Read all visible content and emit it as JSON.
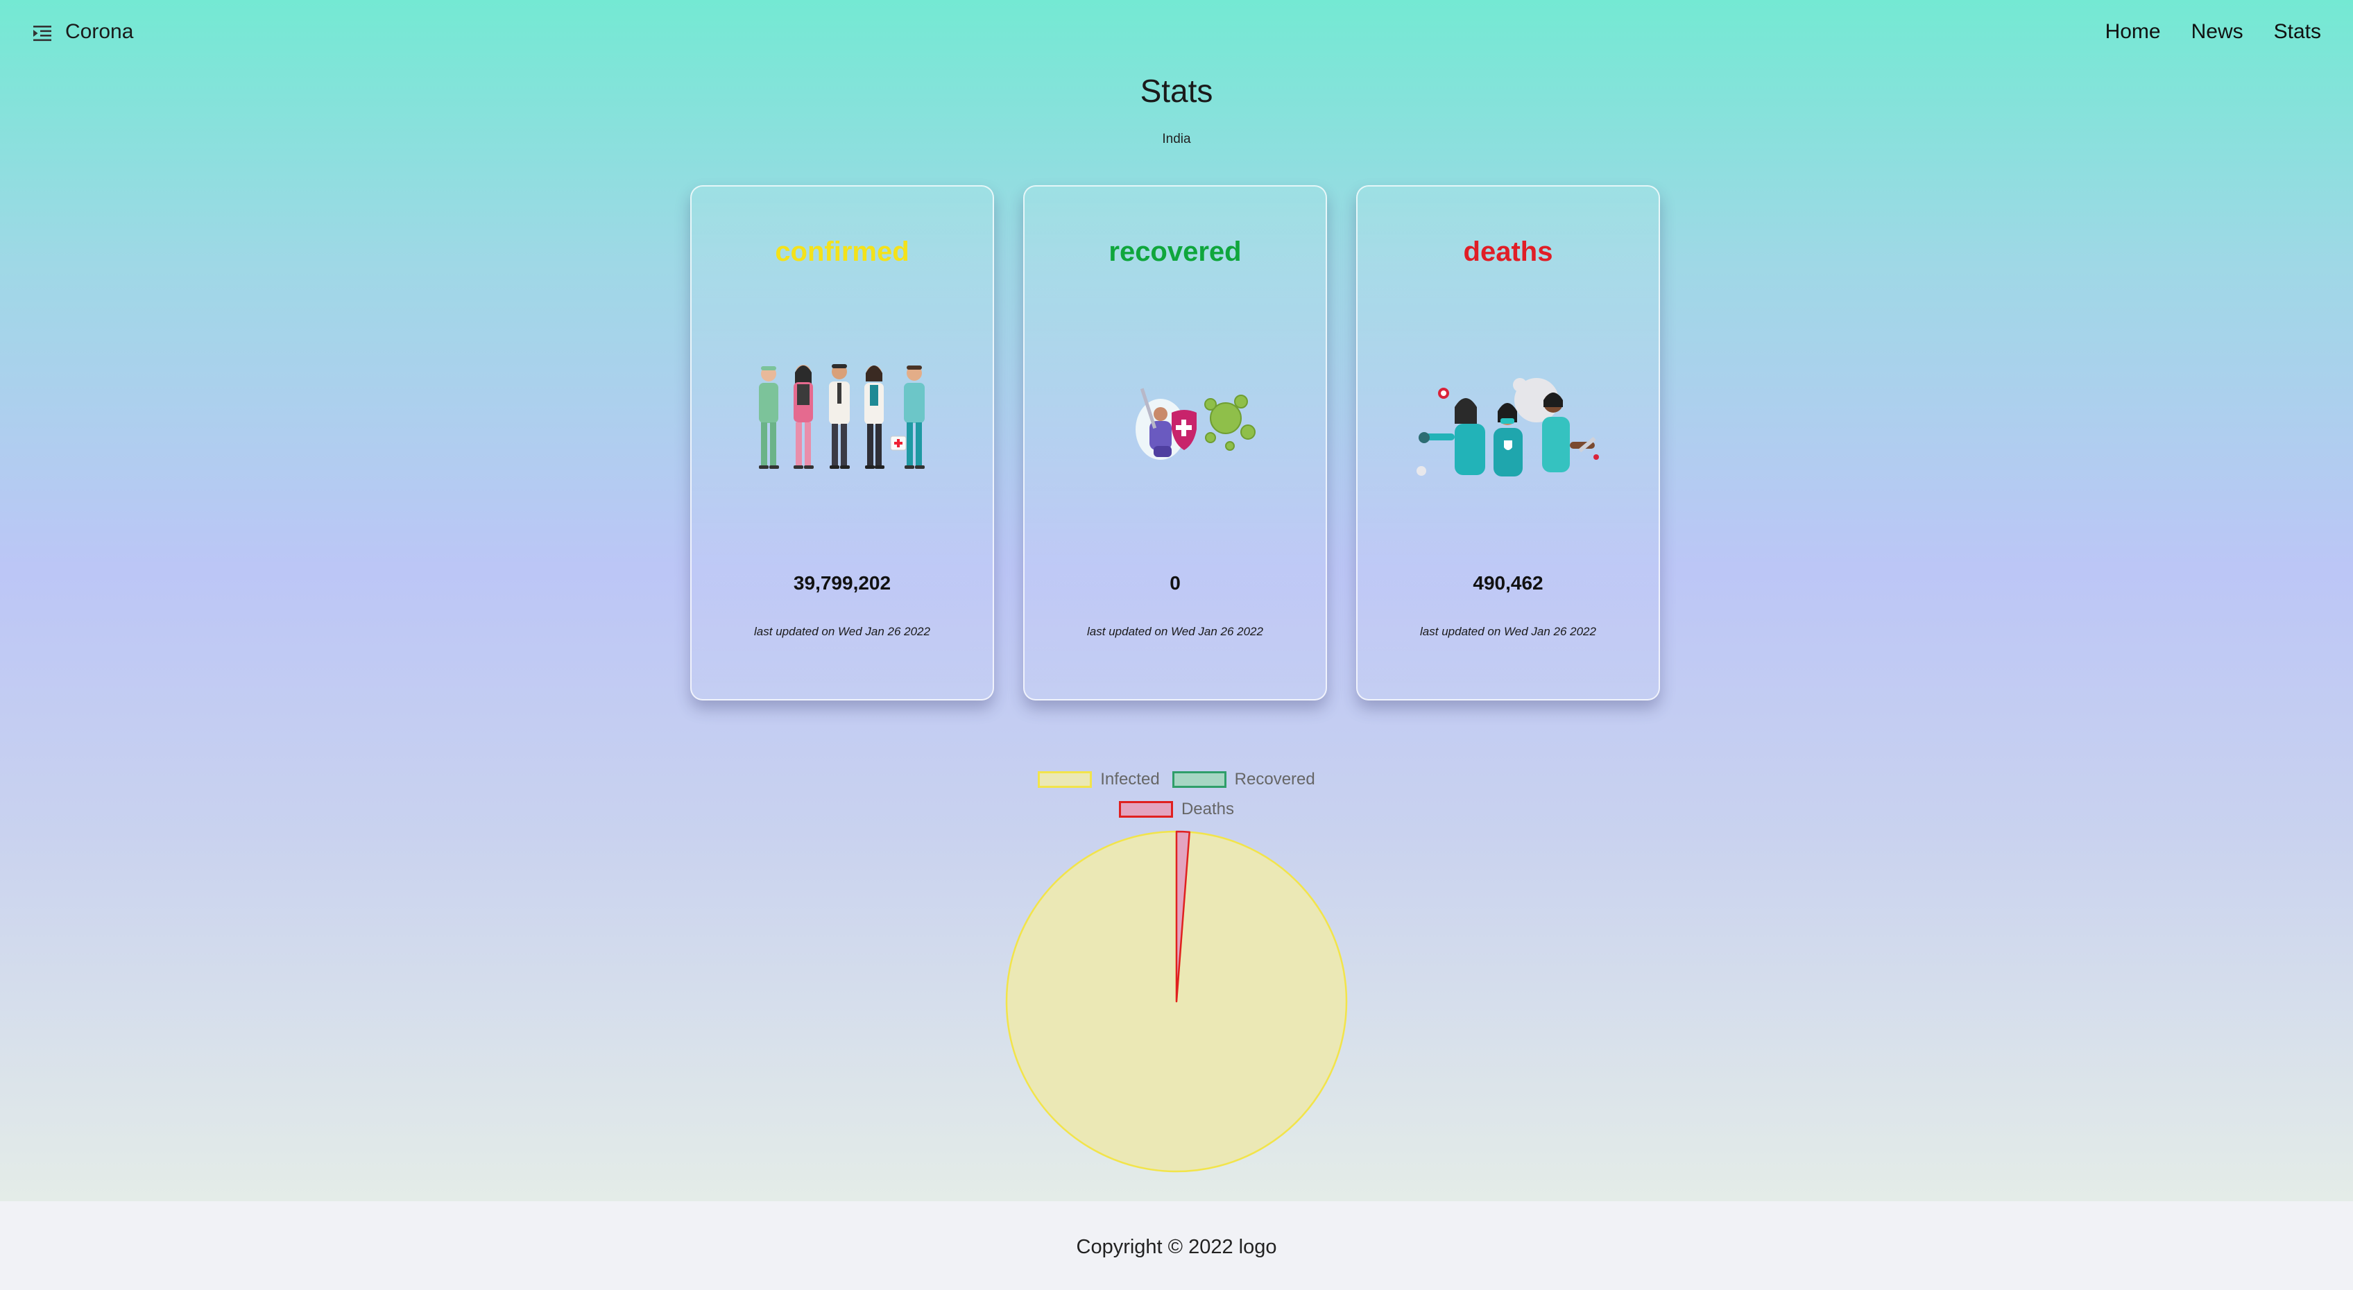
{
  "app": {
    "brand": "Corona"
  },
  "nav": {
    "home": "Home",
    "news": "News",
    "stats": "Stats"
  },
  "page": {
    "title": "Stats",
    "country": "India"
  },
  "cards": [
    {
      "label": "confirmed",
      "value": "39,799,202",
      "updated": "last updated on Wed Jan 26 2022",
      "color": "#f4e21a"
    },
    {
      "label": "recovered",
      "value": "0",
      "updated": "last updated on Wed Jan 26 2022",
      "color": "#0fa63c"
    },
    {
      "label": "deaths",
      "value": "490,462",
      "updated": "last updated on Wed Jan 26 2022",
      "color": "#e01e26"
    }
  ],
  "legend": {
    "infected": "Infected",
    "recovered": "Recovered",
    "deaths": "Deaths"
  },
  "chart_data": {
    "type": "pie",
    "categories": [
      "Infected",
      "Recovered",
      "Deaths"
    ],
    "values": [
      39799202,
      0,
      490462
    ],
    "colors": {
      "infected_fill": "#ebe8b5",
      "infected_border": "#f2e44a",
      "recovered_fill": "#a6d6c3",
      "recovered_border": "#2f9e6a",
      "deaths_fill": "#e3a4c0",
      "deaths_border": "#e02020"
    }
  },
  "footer": {
    "copyright": "Copyright © 2022 logo"
  }
}
